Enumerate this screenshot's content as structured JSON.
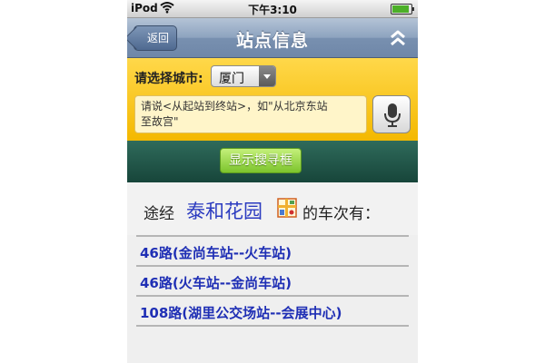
{
  "status_bar": {
    "carrier": "iPod",
    "time": "下午3:10"
  },
  "nav": {
    "back_label": "返回",
    "title": "站点信息"
  },
  "search": {
    "city_label": "请选择城市:",
    "city_value": "厦门",
    "voice_hint_line1": "请说<从起站到终站>，如\"从北京东站",
    "voice_hint_line2": "至故宫\"",
    "show_search_label": "显示搜寻框"
  },
  "result": {
    "prefix": "途经",
    "station": "泰和花园",
    "suffix": "的车次有："
  },
  "routes": [
    "46路(金尚车站--火车站)",
    "46路(火车站--金尚车站)",
    "108路(湖里公交场站--会展中心)"
  ],
  "colors": {
    "nav_blue": "#7890b0",
    "panel_yellow": "#f4b800",
    "band_green": "#17453a",
    "link_blue": "#1f2fb5"
  }
}
